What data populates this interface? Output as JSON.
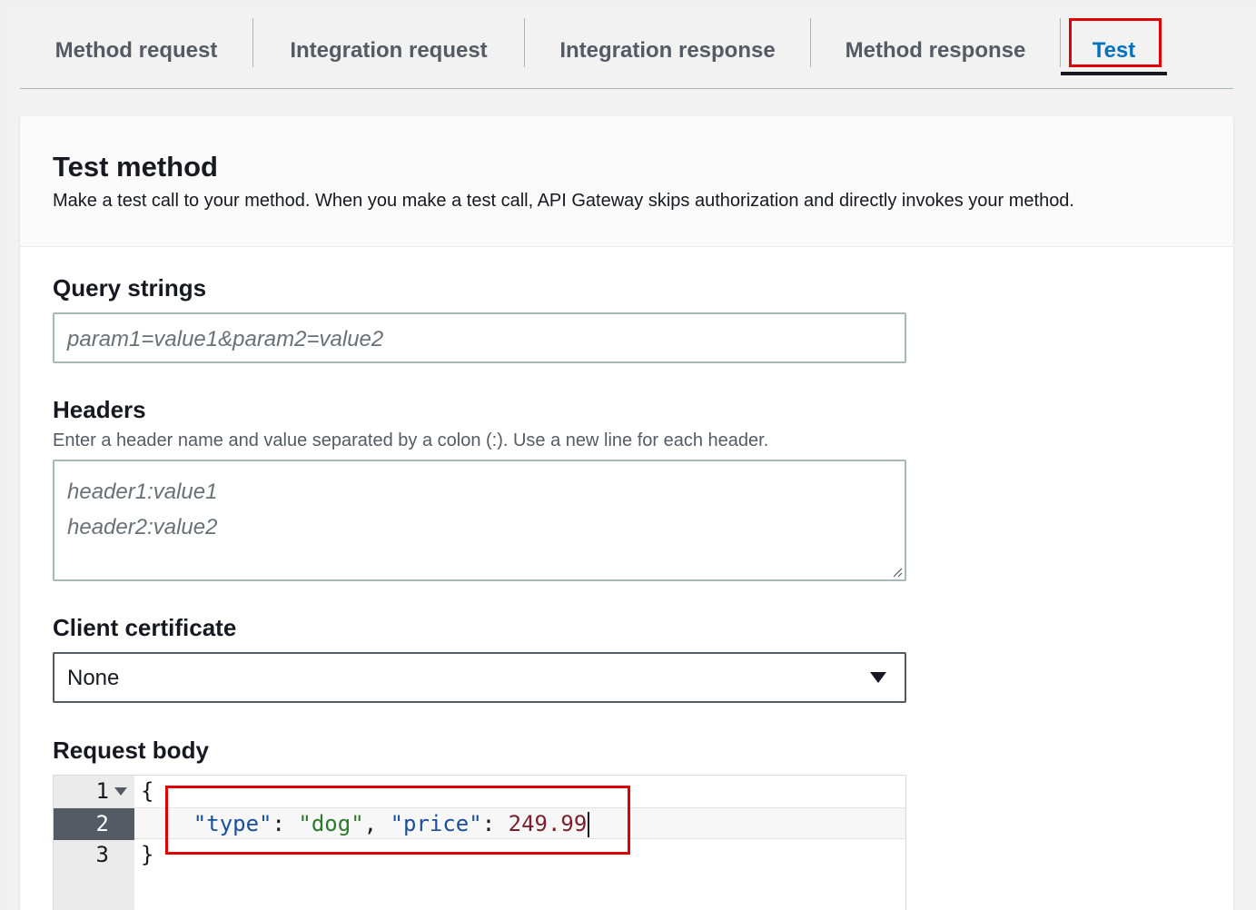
{
  "tabs": [
    {
      "label": "Method request"
    },
    {
      "label": "Integration request"
    },
    {
      "label": "Integration response"
    },
    {
      "label": "Method response"
    },
    {
      "label": "Test",
      "active": true
    }
  ],
  "panel": {
    "title": "Test method",
    "description": "Make a test call to your method. When you make a test call, API Gateway skips authorization and directly invokes your method."
  },
  "query_strings": {
    "label": "Query strings",
    "placeholder": "param1=value1&param2=value2",
    "value": ""
  },
  "headers": {
    "label": "Headers",
    "hint": "Enter a header name and value separated by a colon (:). Use a new line for each header.",
    "placeholder_line1": "header1:value1",
    "placeholder_line2": "header2:value2"
  },
  "client_certificate": {
    "label": "Client certificate",
    "selected": "None"
  },
  "request_body": {
    "label": "Request body",
    "lines": [
      {
        "number": "1",
        "text": "{"
      },
      {
        "number": "2",
        "key1": "\"type\"",
        "val1": "\"dog\"",
        "key2": "\"price\"",
        "val2": "249.99"
      },
      {
        "number": "3",
        "text": "}"
      }
    ]
  },
  "colors": {
    "active_tab": "#0073bb",
    "highlight": "#e00000",
    "json_key": "#1a4f9c",
    "json_string": "#2a7a2a",
    "json_number": "#7a1f2b"
  }
}
